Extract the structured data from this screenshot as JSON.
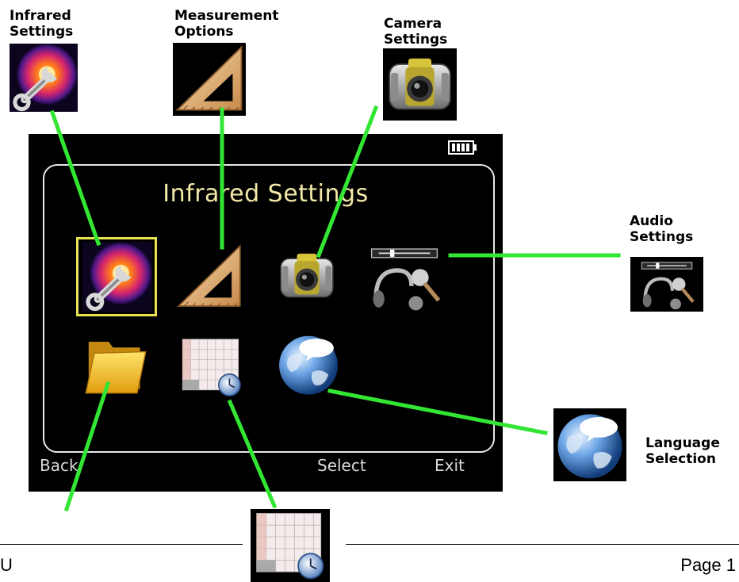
{
  "callouts": {
    "infrared": "Infrared\nSettings",
    "measurement": "Measurement\nOptions",
    "camera": "Camera\nSettings",
    "audio": "Audio\nSettings",
    "language": "Language\nSelection"
  },
  "screen": {
    "title": "Infrared Settings",
    "softkeys": {
      "back": "Back",
      "select": "Select",
      "exit": "Exit"
    },
    "selected_item": "Infrared Settings"
  },
  "icons": [
    {
      "name": "infrared-settings-icon",
      "label": "Infrared Settings"
    },
    {
      "name": "measurement-options-icon",
      "label": "Measurement Options"
    },
    {
      "name": "camera-settings-icon",
      "label": "Camera Settings"
    },
    {
      "name": "audio-settings-icon",
      "label": "Audio Settings"
    },
    {
      "name": "folder-icon"
    },
    {
      "name": "calendar-clock-icon"
    },
    {
      "name": "language-selection-icon",
      "label": "Language Selection"
    }
  ],
  "footer": {
    "left": "U",
    "right": "Page 1"
  },
  "colors": {
    "connector": "#33e633",
    "selection": "#e7e351",
    "title": "#f2e9a8",
    "screen_bg": "#000000"
  }
}
